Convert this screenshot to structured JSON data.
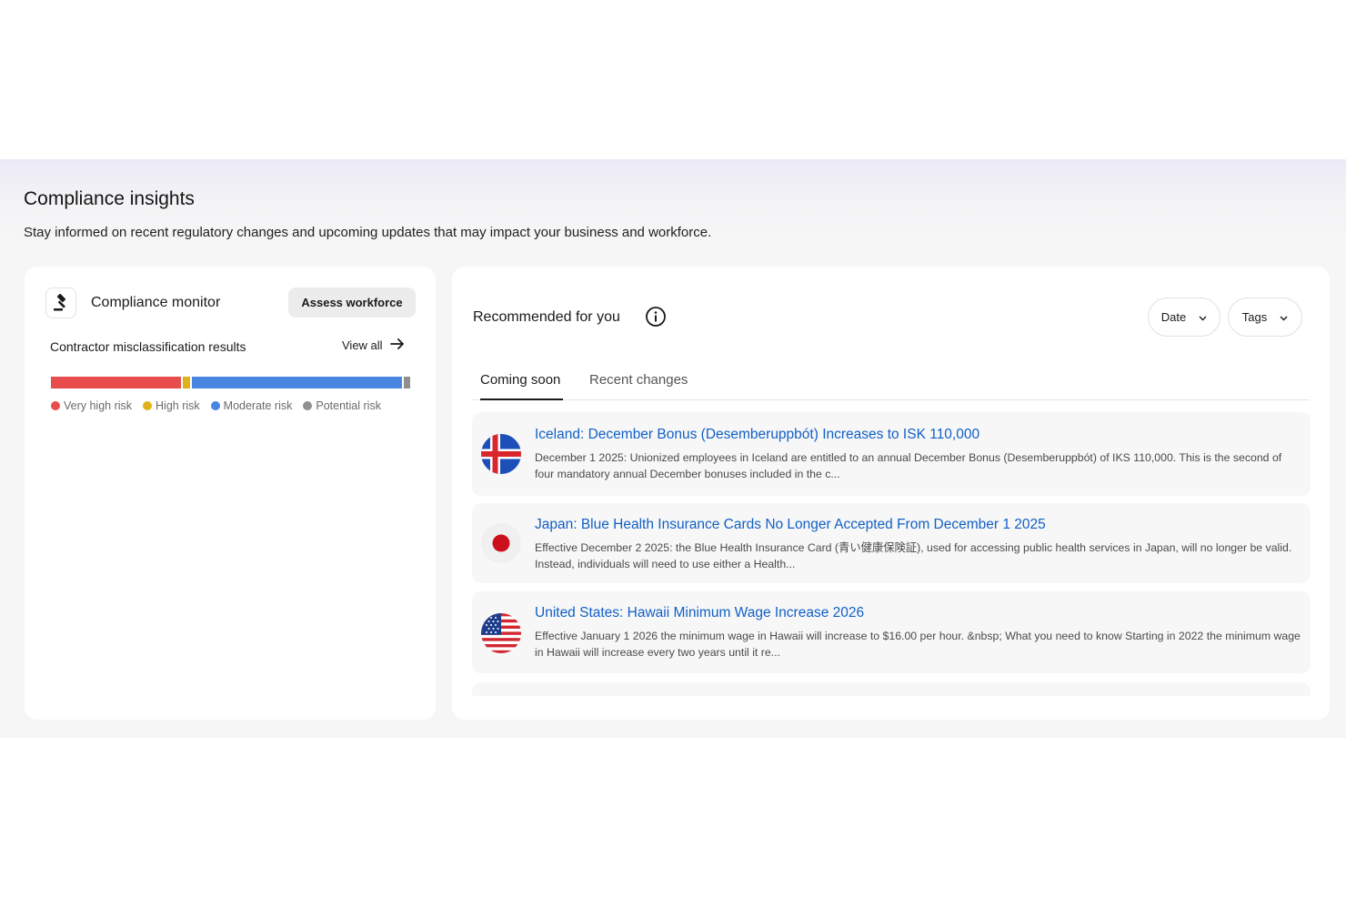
{
  "section": {
    "title": "Compliance insights",
    "subtitle": "Stay informed on recent regulatory changes and upcoming updates that may impact your business and workforce."
  },
  "monitor": {
    "icon": "gavel-icon",
    "title": "Compliance monitor",
    "assess_label": "Assess workforce",
    "results_title": "Contractor misclassification results",
    "view_all_label": "View all",
    "risk_bar": [
      {
        "label": "Very high risk",
        "color": "#e84c4c",
        "fraction": 0.365
      },
      {
        "label": "High risk",
        "color": "#e0b219",
        "fraction": 0.02
      },
      {
        "label": "Moderate risk",
        "color": "#4a86e0",
        "fraction": 0.59
      },
      {
        "label": "Potential risk",
        "color": "#8f8f8f",
        "fraction": 0.017
      }
    ]
  },
  "recommended": {
    "title": "Recommended for you",
    "filters": {
      "date_label": "Date",
      "tags_label": "Tags"
    },
    "tabs": [
      {
        "label": "Coming soon",
        "active": true
      },
      {
        "label": "Recent changes",
        "active": false
      }
    ],
    "items": [
      {
        "flag": "iceland-flag-icon",
        "title": "Iceland: December Bonus (Desemberuppbót) Increases to ISK 110,000",
        "desc": "December 1 2025: Unionized employees in Iceland are entitled to an annual December Bonus (Desemberuppbót) of IKS 110,000. This is the second of four mandatory annual December bonuses included in the c..."
      },
      {
        "flag": "japan-flag-icon",
        "title": "Japan: Blue Health Insurance Cards No Longer Accepted From December 1 2025",
        "desc": "Effective December 2 2025: the Blue Health Insurance Card (青い健康保険証), used for accessing public health services in Japan, will no longer be valid. Instead, individuals will need to use either a Health..."
      },
      {
        "flag": "us-flag-icon",
        "title": "United States: Hawaii Minimum Wage Increase 2026",
        "desc": "Effective January 1 2026 the minimum wage in Hawaii will increase to $16.00 per hour. &nbsp; What you need to know Starting in 2022 the minimum wage in Hawaii will increase every two years until it re..."
      }
    ]
  }
}
